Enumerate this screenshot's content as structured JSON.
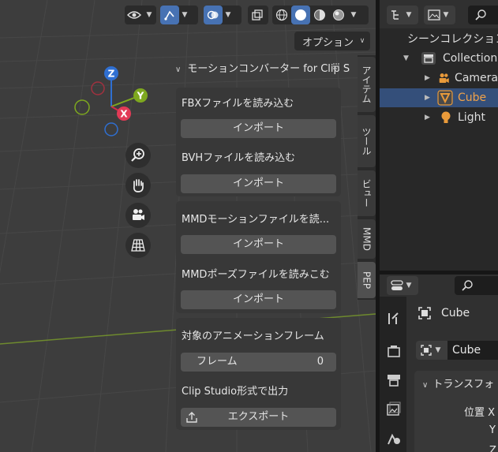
{
  "viewport": {
    "options_label": "オプション"
  },
  "navigation_gizmo": {
    "z_label": "Z",
    "y_label": "Y",
    "x_label": "X"
  },
  "panel": {
    "title": "モーションコンバーター for Clip S",
    "fbx_label": "FBXファイルを読み込む",
    "fbx_button": "インポート",
    "bvh_label": "BVHファイルを読み込む",
    "bvh_button": "インポート",
    "mmd_motion_label": "MMDモーションファイルを読...",
    "mmd_motion_button": "インポート",
    "mmd_pose_label": "MMDポーズファイルを読みこむ",
    "mmd_pose_button": "インポート",
    "frame_section_label": "対象のアニメーションフレーム",
    "frame_field_label": "フレーム",
    "frame_field_value": "0",
    "export_label": "Clip Studio形式で出力",
    "export_button": "エクスポート"
  },
  "tabs": [
    {
      "label": "アイテム"
    },
    {
      "label": "ツール"
    },
    {
      "label": "ビュー"
    },
    {
      "label": "MMD"
    },
    {
      "label": "PEP"
    }
  ],
  "outliner": {
    "scene_collection": "シーンコレクション",
    "collection": "Collection",
    "items": [
      {
        "label": "Camera"
      },
      {
        "label": "Cube"
      },
      {
        "label": "Light"
      }
    ]
  },
  "properties": {
    "object_name": "Cube",
    "mesh_name": "Cube",
    "transform_label": "トランスフォ",
    "location_label": "位置 X",
    "y_label": "Y",
    "z_label": "Z"
  }
}
